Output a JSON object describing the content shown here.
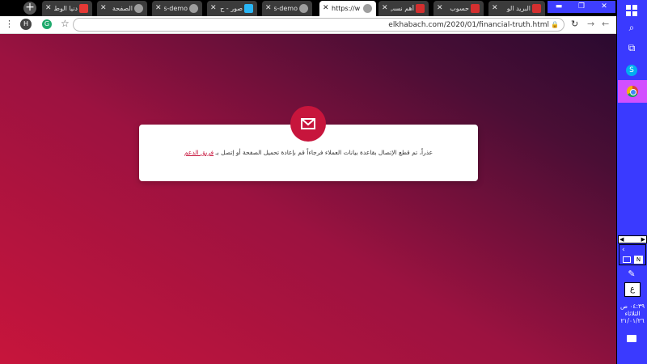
{
  "browser": {
    "new_tab_symbol": "+",
    "tabs": [
      {
        "title": "دنيا الوطن",
        "favicon_color": "#e53935",
        "active": false
      },
      {
        "title": "الصفحة",
        "favicon_color": "#9e9e9e",
        "active": false
      },
      {
        "title": "nas-demo",
        "favicon_color": "#9e9e9e",
        "active": false
      },
      {
        "title": "صور - ح",
        "favicon_color": "#29b6f6",
        "active": false
      },
      {
        "title": "nas-demo",
        "favicon_color": "#9e9e9e",
        "active": false
      },
      {
        "title": "https://w",
        "favicon_color": "#9e9e9e",
        "active": true
      },
      {
        "title": "أهم نسب",
        "favicon_color": "#d32f2f",
        "active": false
      },
      {
        "title": "حسوب",
        "favicon_color": "#d32f2f",
        "active": false
      },
      {
        "title": "البريد الو",
        "favicon_color": "#d32f2f",
        "active": false
      }
    ],
    "close_symbol": "✕",
    "window_buttons": {
      "minimize": "▬",
      "restore": "❐",
      "close": "✕"
    },
    "address_bar": {
      "menu_symbol": "⋮",
      "avatar_letter": "H",
      "extension_letter": "G",
      "url": "elkhabach.com/2020/01/financial-truth.html",
      "lock_icon": "lock-icon",
      "reload_symbol": "↻",
      "back_symbol": "←",
      "forward_symbol": "→"
    }
  },
  "page": {
    "message": "عذراً، تم قطع الإتصال بقاعدة بيانات العملاء فرجاءاً قم بإعادة تحميل الصفحة أو إتصل بـ",
    "link_text": "فريق الدعم",
    "accent_color": "#c7153c"
  },
  "taskbar": {
    "keyboard_layout": "ع",
    "clock_time": "٠٤:٣٩ ص",
    "clock_day": "الثلاثاء",
    "clock_date": "٢١/٠١/٢٦"
  }
}
